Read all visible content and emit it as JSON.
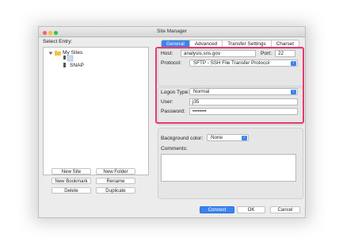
{
  "window": {
    "title": "Site Manager"
  },
  "left": {
    "select_entry_label": "Select Entry:",
    "tree": {
      "root_label": "My Sites",
      "child_label": "SNAP"
    },
    "buttons": {
      "new_site": "New Site",
      "new_folder": "New Folder",
      "new_bookmark": "New Bookmark",
      "rename": "Rename",
      "delete": "Delete",
      "duplicate": "Duplicate"
    }
  },
  "tabs": [
    {
      "label": "General",
      "active": true
    },
    {
      "label": "Advanced",
      "active": false
    },
    {
      "label": "Transfer Settings",
      "active": false
    },
    {
      "label": "Charset",
      "active": false
    }
  ],
  "form": {
    "host_label": "Host:",
    "host_value": "analysis.sns.gov",
    "port_label": "Port:",
    "port_value": "22",
    "protocol_label": "Protocol:",
    "protocol_value": "SFTP - SSH File Transfer Protocol",
    "logon_type_label": "Logon Type:",
    "logon_type_value": "Normal",
    "user_label": "User:",
    "user_value": "j35",
    "password_label": "Password:",
    "password_value": "••••••••",
    "bg_color_label": "Background color:",
    "bg_color_value": "None",
    "comments_label": "Comments:",
    "comments_value": ""
  },
  "footer": {
    "connect": "Connect",
    "ok": "OK",
    "cancel": "Cancel"
  },
  "colors": {
    "accent": "#3a84f0",
    "highlight_border": "#e63a6c",
    "folder": "#f5c242"
  },
  "icons": [
    "folder-icon",
    "site-icon",
    "chevron-down-icon",
    "disclosure-triangle-icon"
  ]
}
